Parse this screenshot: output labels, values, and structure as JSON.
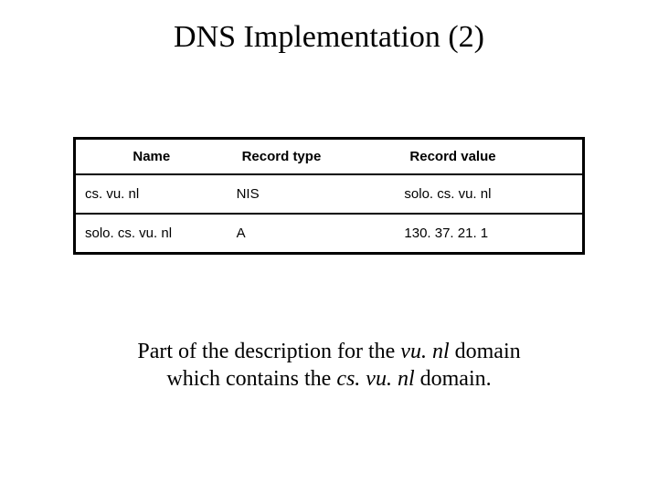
{
  "title": "DNS Implementation (2)",
  "table": {
    "headers": {
      "name": "Name",
      "type": "Record type",
      "value": "Record value"
    },
    "rows": [
      {
        "name": "cs. vu. nl",
        "type": "NIS",
        "value": "solo. cs. vu. nl"
      },
      {
        "name": "solo. cs. vu. nl",
        "type": "A",
        "value": "130. 37. 21. 1"
      }
    ]
  },
  "caption": {
    "pre1": "Part of the description for the ",
    "dom1": "vu. nl",
    "mid": " domain",
    "line2a": "which contains the ",
    "dom2": "cs. vu. nl",
    "line2b": " domain."
  }
}
